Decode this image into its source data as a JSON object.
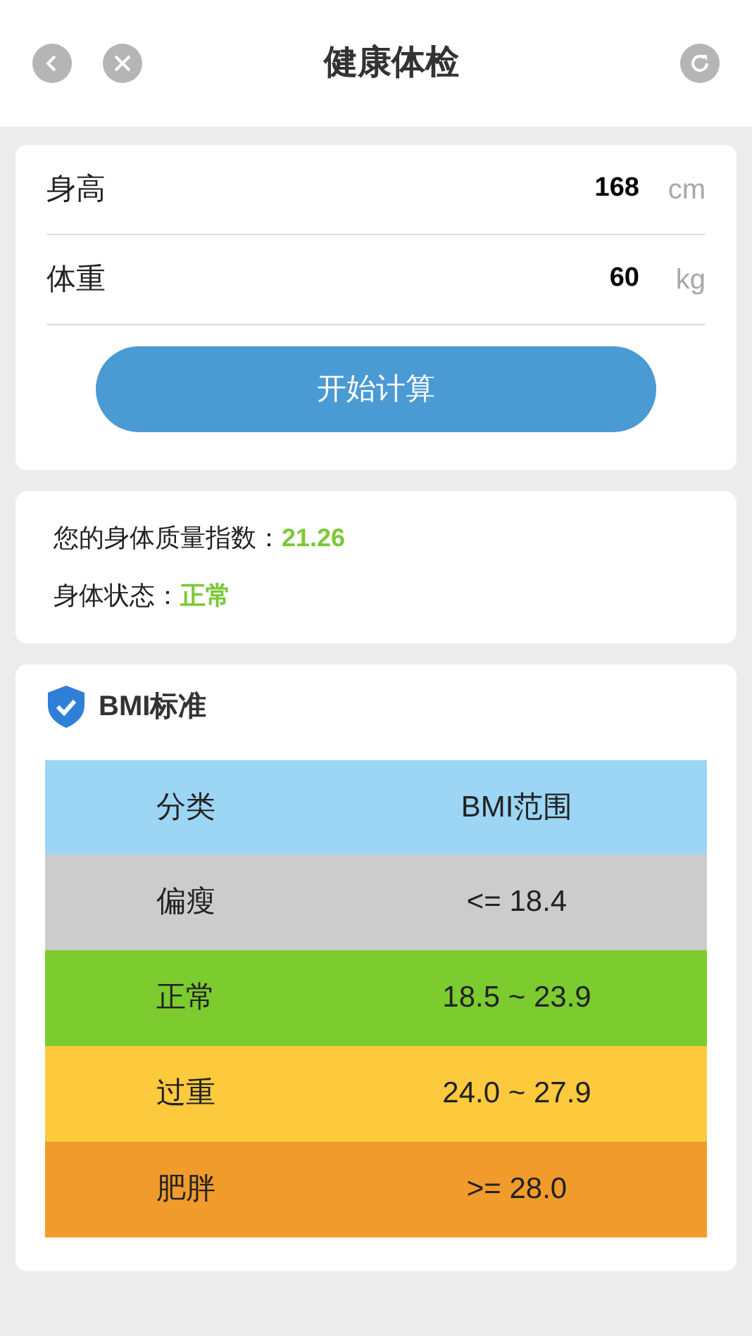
{
  "header": {
    "title": "健康体检"
  },
  "inputs": [
    {
      "label": "身高",
      "value": "168",
      "unit": "cm"
    },
    {
      "label": "体重",
      "value": "60",
      "unit": "kg"
    }
  ],
  "calculate_button": "开始计算",
  "result": [
    {
      "label": "您的身体质量指数：",
      "value": "21.26"
    },
    {
      "label": "身体状态：",
      "value": "正常"
    }
  ],
  "bmi_standard": {
    "title": "BMI标准",
    "header": {
      "columns": [
        "分类",
        "BMI范围"
      ],
      "color": "#9dd5f5"
    },
    "rows": [
      {
        "category": "偏瘦",
        "range": "<= 18.4",
        "color": "#cccccc"
      },
      {
        "category": "正常",
        "range": "18.5 ~ 23.9",
        "color": "#7ccb2f"
      },
      {
        "category": "过重",
        "range": "24.0 ~ 27.9",
        "color": "#fdc93d"
      },
      {
        "category": "肥胖",
        "range": ">= 28.0",
        "color": "#f19b2c"
      }
    ]
  }
}
